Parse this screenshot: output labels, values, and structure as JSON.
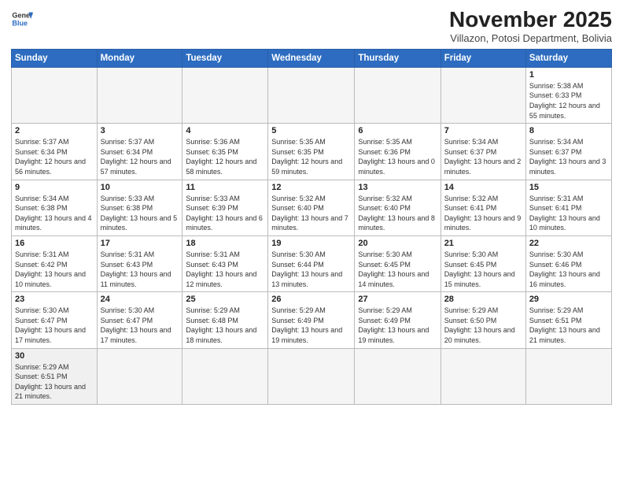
{
  "logo": {
    "line1": "General",
    "line2": "Blue"
  },
  "header": {
    "month": "November 2025",
    "location": "Villazon, Potosi Department, Bolivia"
  },
  "weekdays": [
    "Sunday",
    "Monday",
    "Tuesday",
    "Wednesday",
    "Thursday",
    "Friday",
    "Saturday"
  ],
  "weeks": [
    [
      {
        "day": "",
        "info": ""
      },
      {
        "day": "",
        "info": ""
      },
      {
        "day": "",
        "info": ""
      },
      {
        "day": "",
        "info": ""
      },
      {
        "day": "",
        "info": ""
      },
      {
        "day": "",
        "info": ""
      },
      {
        "day": "1",
        "info": "Sunrise: 5:38 AM\nSunset: 6:33 PM\nDaylight: 12 hours\nand 55 minutes."
      }
    ],
    [
      {
        "day": "2",
        "info": "Sunrise: 5:37 AM\nSunset: 6:34 PM\nDaylight: 12 hours\nand 56 minutes."
      },
      {
        "day": "3",
        "info": "Sunrise: 5:37 AM\nSunset: 6:34 PM\nDaylight: 12 hours\nand 57 minutes."
      },
      {
        "day": "4",
        "info": "Sunrise: 5:36 AM\nSunset: 6:35 PM\nDaylight: 12 hours\nand 58 minutes."
      },
      {
        "day": "5",
        "info": "Sunrise: 5:35 AM\nSunset: 6:35 PM\nDaylight: 12 hours\nand 59 minutes."
      },
      {
        "day": "6",
        "info": "Sunrise: 5:35 AM\nSunset: 6:36 PM\nDaylight: 13 hours\nand 0 minutes."
      },
      {
        "day": "7",
        "info": "Sunrise: 5:34 AM\nSunset: 6:37 PM\nDaylight: 13 hours\nand 2 minutes."
      },
      {
        "day": "8",
        "info": "Sunrise: 5:34 AM\nSunset: 6:37 PM\nDaylight: 13 hours\nand 3 minutes."
      }
    ],
    [
      {
        "day": "9",
        "info": "Sunrise: 5:34 AM\nSunset: 6:38 PM\nDaylight: 13 hours\nand 4 minutes."
      },
      {
        "day": "10",
        "info": "Sunrise: 5:33 AM\nSunset: 6:38 PM\nDaylight: 13 hours\nand 5 minutes."
      },
      {
        "day": "11",
        "info": "Sunrise: 5:33 AM\nSunset: 6:39 PM\nDaylight: 13 hours\nand 6 minutes."
      },
      {
        "day": "12",
        "info": "Sunrise: 5:32 AM\nSunset: 6:40 PM\nDaylight: 13 hours\nand 7 minutes."
      },
      {
        "day": "13",
        "info": "Sunrise: 5:32 AM\nSunset: 6:40 PM\nDaylight: 13 hours\nand 8 minutes."
      },
      {
        "day": "14",
        "info": "Sunrise: 5:32 AM\nSunset: 6:41 PM\nDaylight: 13 hours\nand 9 minutes."
      },
      {
        "day": "15",
        "info": "Sunrise: 5:31 AM\nSunset: 6:41 PM\nDaylight: 13 hours\nand 10 minutes."
      }
    ],
    [
      {
        "day": "16",
        "info": "Sunrise: 5:31 AM\nSunset: 6:42 PM\nDaylight: 13 hours\nand 10 minutes."
      },
      {
        "day": "17",
        "info": "Sunrise: 5:31 AM\nSunset: 6:43 PM\nDaylight: 13 hours\nand 11 minutes."
      },
      {
        "day": "18",
        "info": "Sunrise: 5:31 AM\nSunset: 6:43 PM\nDaylight: 13 hours\nand 12 minutes."
      },
      {
        "day": "19",
        "info": "Sunrise: 5:30 AM\nSunset: 6:44 PM\nDaylight: 13 hours\nand 13 minutes."
      },
      {
        "day": "20",
        "info": "Sunrise: 5:30 AM\nSunset: 6:45 PM\nDaylight: 13 hours\nand 14 minutes."
      },
      {
        "day": "21",
        "info": "Sunrise: 5:30 AM\nSunset: 6:45 PM\nDaylight: 13 hours\nand 15 minutes."
      },
      {
        "day": "22",
        "info": "Sunrise: 5:30 AM\nSunset: 6:46 PM\nDaylight: 13 hours\nand 16 minutes."
      }
    ],
    [
      {
        "day": "23",
        "info": "Sunrise: 5:30 AM\nSunset: 6:47 PM\nDaylight: 13 hours\nand 17 minutes."
      },
      {
        "day": "24",
        "info": "Sunrise: 5:30 AM\nSunset: 6:47 PM\nDaylight: 13 hours\nand 17 minutes."
      },
      {
        "day": "25",
        "info": "Sunrise: 5:29 AM\nSunset: 6:48 PM\nDaylight: 13 hours\nand 18 minutes."
      },
      {
        "day": "26",
        "info": "Sunrise: 5:29 AM\nSunset: 6:49 PM\nDaylight: 13 hours\nand 19 minutes."
      },
      {
        "day": "27",
        "info": "Sunrise: 5:29 AM\nSunset: 6:49 PM\nDaylight: 13 hours\nand 19 minutes."
      },
      {
        "day": "28",
        "info": "Sunrise: 5:29 AM\nSunset: 6:50 PM\nDaylight: 13 hours\nand 20 minutes."
      },
      {
        "day": "29",
        "info": "Sunrise: 5:29 AM\nSunset: 6:51 PM\nDaylight: 13 hours\nand 21 minutes."
      }
    ],
    [
      {
        "day": "30",
        "info": "Sunrise: 5:29 AM\nSunset: 6:51 PM\nDaylight: 13 hours\nand 21 minutes."
      },
      {
        "day": "",
        "info": ""
      },
      {
        "day": "",
        "info": ""
      },
      {
        "day": "",
        "info": ""
      },
      {
        "day": "",
        "info": ""
      },
      {
        "day": "",
        "info": ""
      },
      {
        "day": "",
        "info": ""
      }
    ]
  ]
}
